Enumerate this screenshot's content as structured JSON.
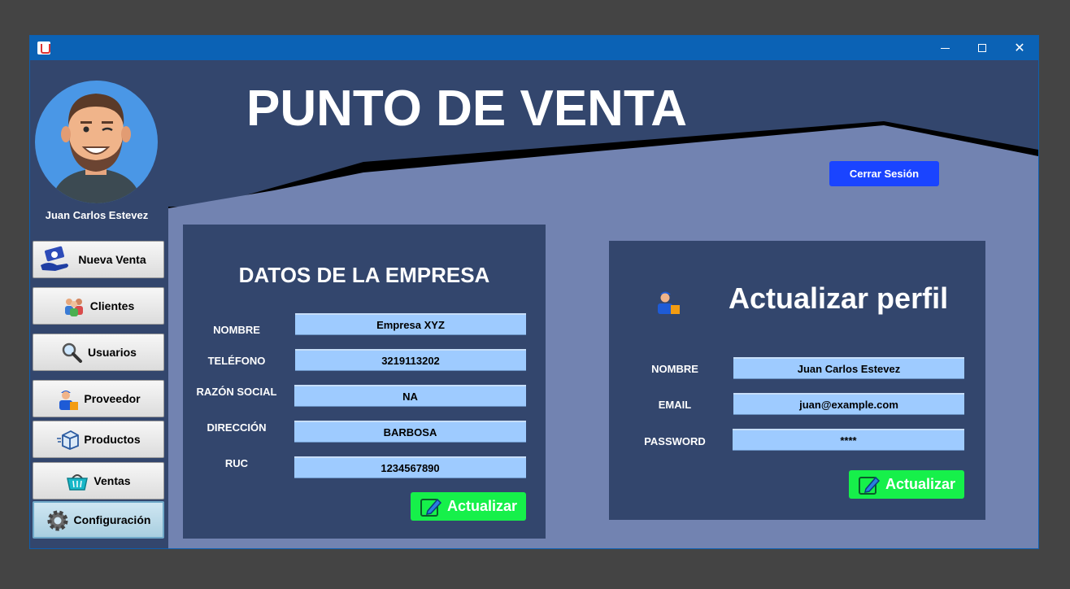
{
  "window": {
    "title": ""
  },
  "header": {
    "title": "PUNTO DE VENTA",
    "logout_label": "Cerrar Sesión"
  },
  "user": {
    "name": "Juan Carlos Estevez"
  },
  "sidebar": {
    "items": [
      {
        "label": "Nueva Venta",
        "icon": "money-hand-icon"
      },
      {
        "label": "Clientes",
        "icon": "customers-icon"
      },
      {
        "label": "Usuarios",
        "icon": "magnifier-icon"
      },
      {
        "label": "Proveedor",
        "icon": "delivery-person-icon"
      },
      {
        "label": "Productos",
        "icon": "box-icon"
      },
      {
        "label": "Ventas",
        "icon": "basket-icon"
      },
      {
        "label": "Configuración",
        "icon": "gear-icon"
      }
    ]
  },
  "company": {
    "title": "DATOS DE LA EMPRESA",
    "fields": [
      {
        "label": "NOMBRE",
        "value": "Empresa XYZ"
      },
      {
        "label": "TELÉFONO",
        "value": "3219113202"
      },
      {
        "label": "RAZÓN SOCIAL",
        "value": "NA"
      },
      {
        "label": "DIRECCIÓN",
        "value": "BARBOSA"
      },
      {
        "label": "RUC",
        "value": "1234567890"
      }
    ],
    "update_label": "Actualizar"
  },
  "profile": {
    "title": "Actualizar perfil",
    "fields": [
      {
        "label": "NOMBRE",
        "value": "Juan Carlos Estevez"
      },
      {
        "label": "EMAIL",
        "value": "juan@example.com"
      },
      {
        "label": "PASSWORD",
        "value": "****"
      }
    ],
    "update_label": "Actualizar"
  },
  "colors": {
    "background": "#33466d",
    "content_area": "#7283b1",
    "field": "#9ecbff",
    "update_button": "#16f04a",
    "logout_button": "#1a44ff",
    "titlebar": "#0b62b5"
  }
}
